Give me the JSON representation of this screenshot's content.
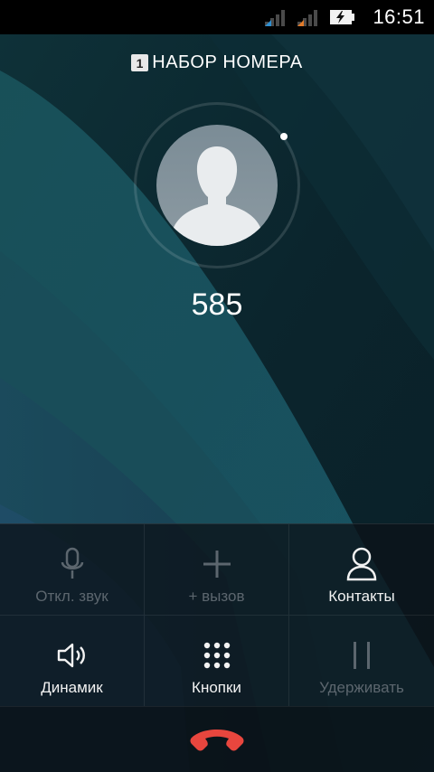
{
  "status_bar": {
    "time": "16:51",
    "icons": [
      "signal-sim1-icon",
      "signal-sim2-icon",
      "battery-charging-icon"
    ]
  },
  "call": {
    "sim_slot": "1",
    "state": "НАБОР НОМЕРА",
    "number": "585"
  },
  "controls": [
    {
      "label": "Откл. звук",
      "icon": "microphone-icon",
      "enabled": false
    },
    {
      "label": "+ вызов",
      "icon": "add-call-icon",
      "enabled": false
    },
    {
      "label": "Контакты",
      "icon": "contacts-icon",
      "enabled": true
    },
    {
      "label": "Динамик",
      "icon": "speaker-icon",
      "enabled": true
    },
    {
      "label": "Кнопки",
      "icon": "dialpad-icon",
      "enabled": true
    },
    {
      "label": "Удерживать",
      "icon": "hold-icon",
      "enabled": false
    }
  ],
  "end_call": {
    "icon": "end-call-icon",
    "color": "#e8463e"
  },
  "colors": {
    "wallpaper_dark": "#0c2a32",
    "wallpaper_teal": "#1f5d6b",
    "wallpaper_blue": "#1f4d6e"
  }
}
